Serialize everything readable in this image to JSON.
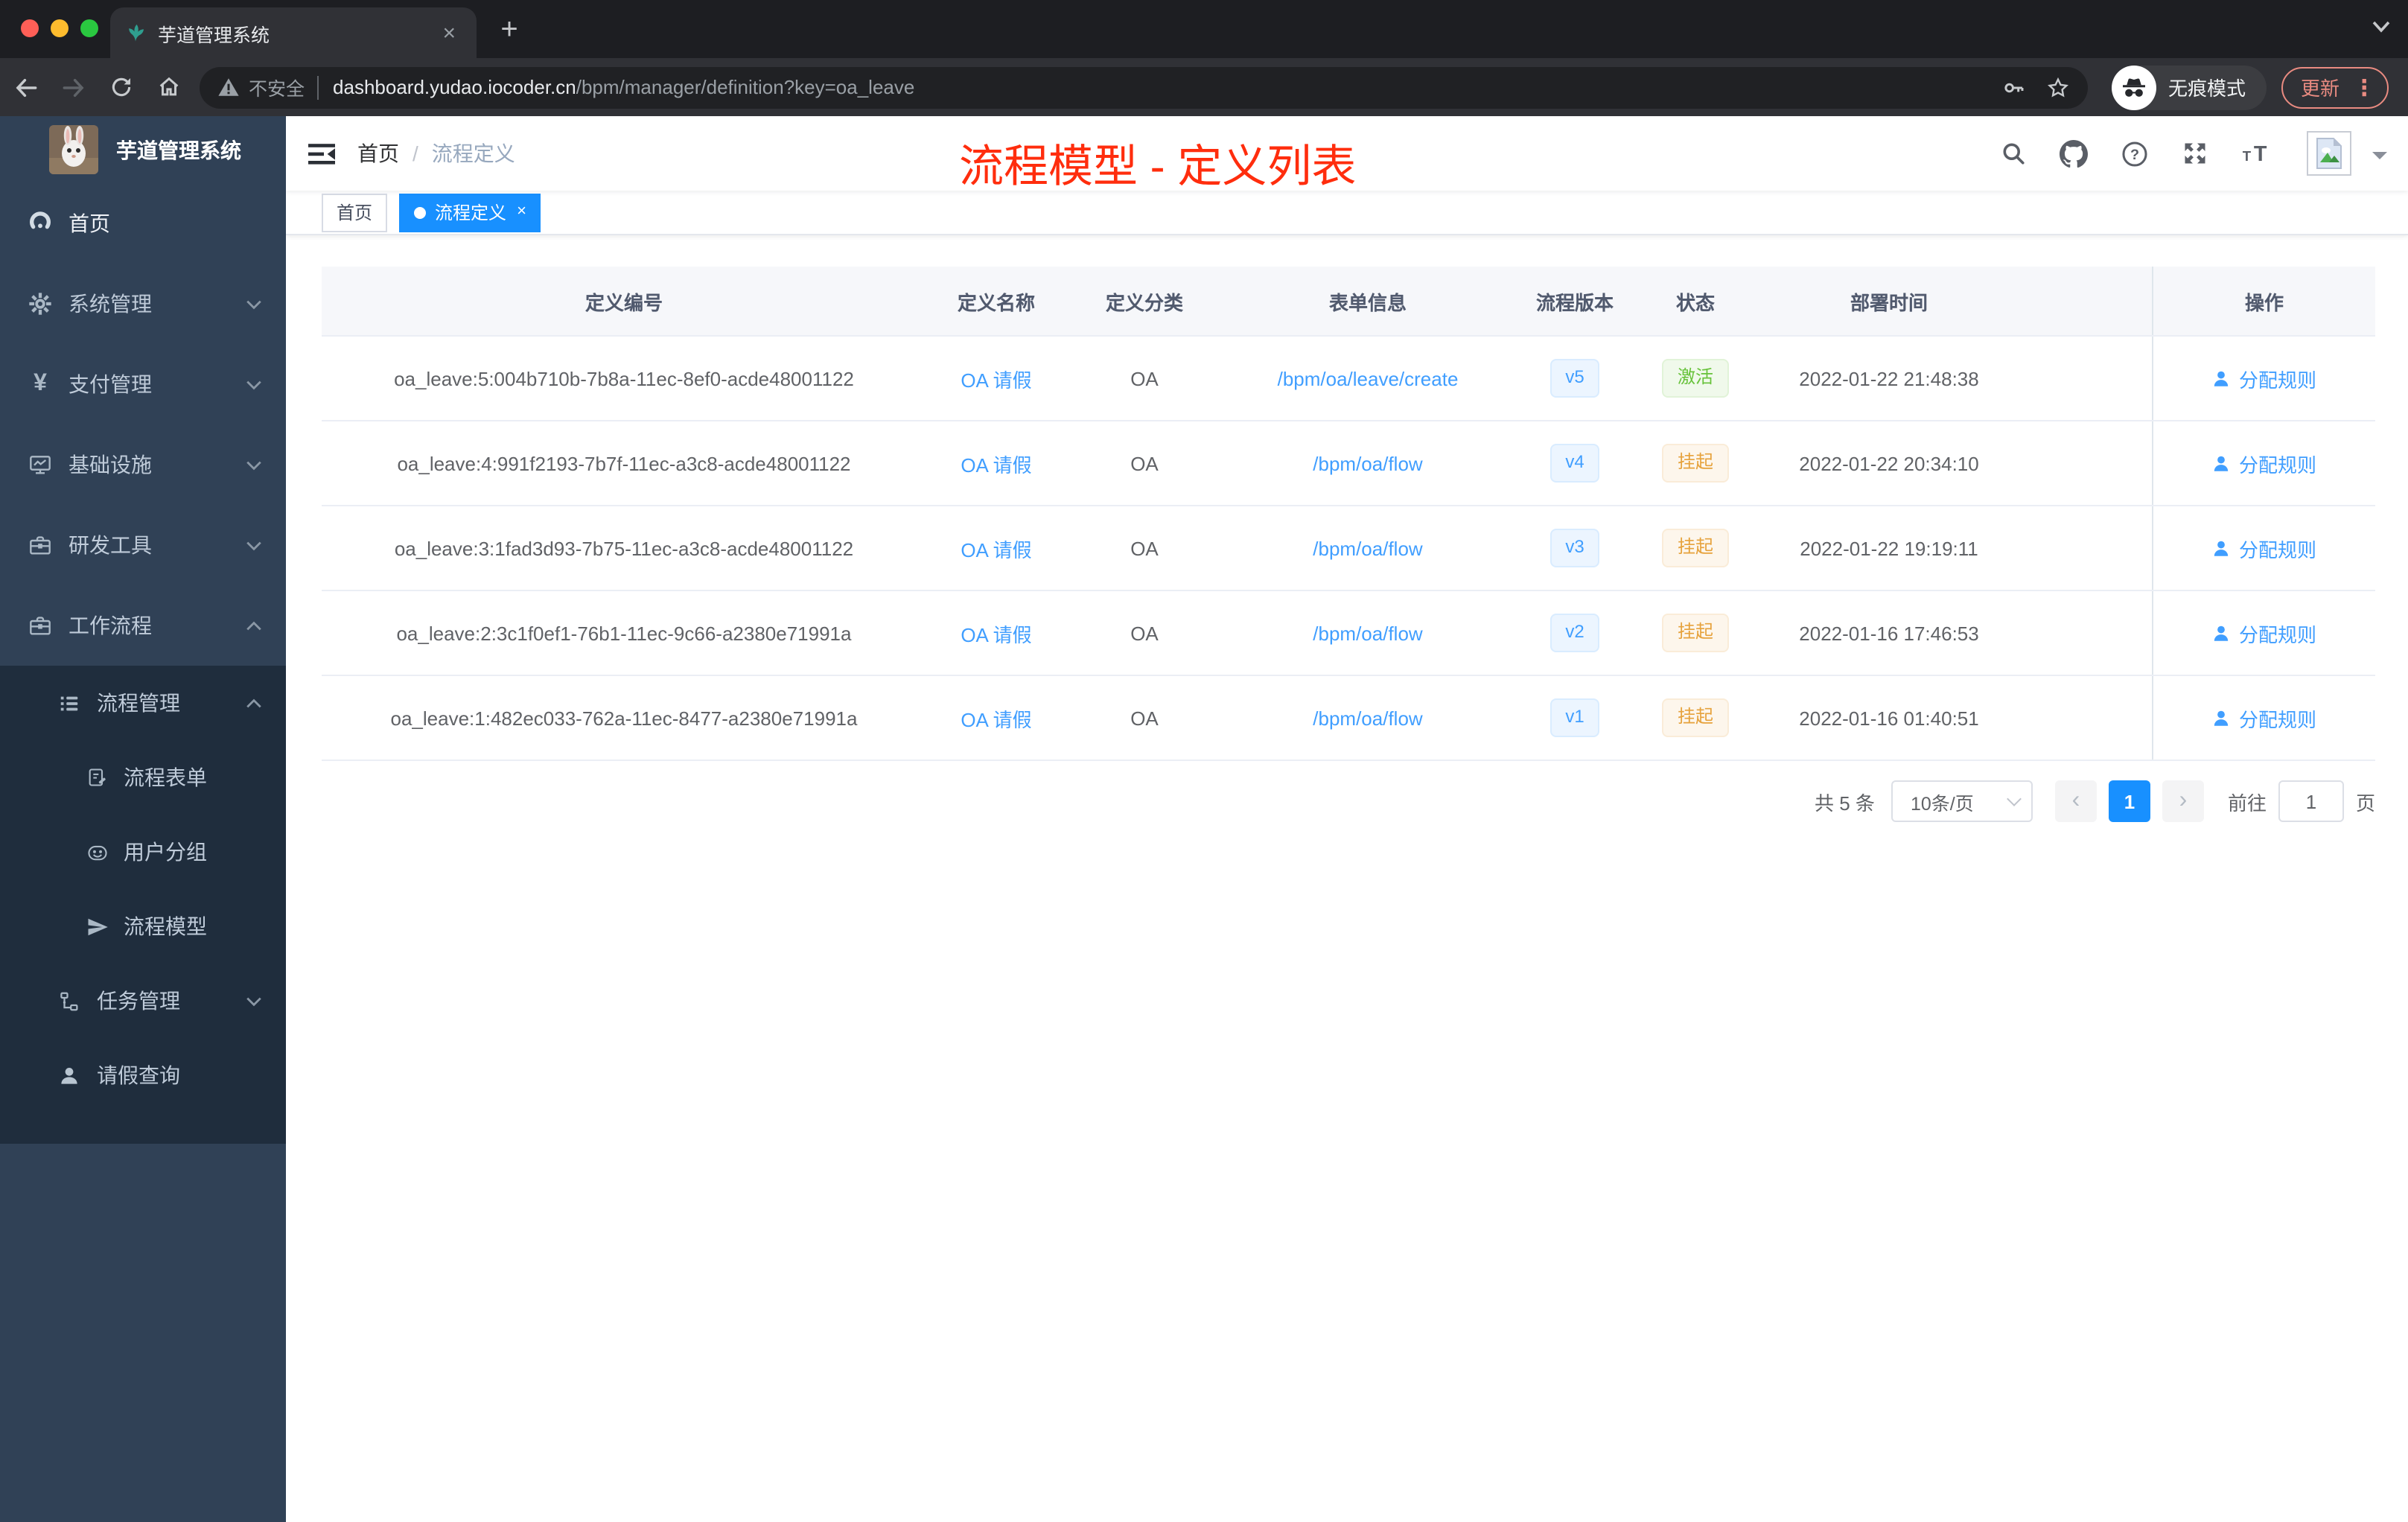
{
  "browser": {
    "tab_title": "芋道管理系统",
    "close_tab": "×",
    "new_tab": "+",
    "security_label": "不安全",
    "url_host": "dashboard.yudao.iocoder.cn",
    "url_path": "/bpm/manager/definition?key=oa_leave",
    "incognito_label": "无痕模式",
    "update_label": "更新",
    "menu_dots": "⋮"
  },
  "sidebar": {
    "logo_title": "芋道管理系统",
    "items": [
      {
        "label": "首页",
        "icon": "dashboard-icon"
      },
      {
        "label": "系统管理",
        "icon": "gear-icon"
      },
      {
        "label": "支付管理",
        "icon": "yen-icon",
        "yen_glyph": "¥"
      },
      {
        "label": "基础设施",
        "icon": "monitor-icon"
      },
      {
        "label": "研发工具",
        "icon": "toolbox-icon"
      },
      {
        "label": "工作流程",
        "icon": "toolbox-icon",
        "expanded": true
      }
    ],
    "submenu": {
      "groups": [
        {
          "label": "流程管理",
          "icon": "list-icon",
          "expanded": true
        },
        {
          "label": "任务管理",
          "icon": "tree-icon",
          "expanded": false
        },
        {
          "label": "请假查询",
          "icon": "user-icon"
        }
      ],
      "children": [
        {
          "label": "流程表单",
          "icon": "form-icon"
        },
        {
          "label": "用户分组",
          "icon": "robot-icon"
        },
        {
          "label": "流程模型",
          "icon": "paper-plane-icon"
        }
      ]
    }
  },
  "navbar": {
    "breadcrumb": {
      "home": "首页",
      "separator": "/",
      "current": "流程定义"
    },
    "annotation": "流程模型 - 定义列表"
  },
  "tags": {
    "home": "首页",
    "active": "流程定义",
    "close": "×"
  },
  "table": {
    "headers": [
      "定义编号",
      "定义名称",
      "定义分类",
      "表单信息",
      "流程版本",
      "状态",
      "部署时间",
      "操作"
    ],
    "rows": [
      {
        "id": "oa_leave:5:004b710b-7b8a-11ec-8ef0-acde48001122",
        "name": "OA 请假",
        "category": "OA",
        "form": "/bpm/oa/leave/create",
        "version": "v5",
        "status": "激活",
        "status_type": "success",
        "deploy_time": "2022-01-22 21:48:38",
        "action": "分配规则"
      },
      {
        "id": "oa_leave:4:991f2193-7b7f-11ec-a3c8-acde48001122",
        "name": "OA 请假",
        "category": "OA",
        "form": "/bpm/oa/flow",
        "version": "v4",
        "status": "挂起",
        "status_type": "warning",
        "deploy_time": "2022-01-22 20:34:10",
        "action": "分配规则"
      },
      {
        "id": "oa_leave:3:1fad3d93-7b75-11ec-a3c8-acde48001122",
        "name": "OA 请假",
        "category": "OA",
        "form": "/bpm/oa/flow",
        "version": "v3",
        "status": "挂起",
        "status_type": "warning",
        "deploy_time": "2022-01-22 19:19:11",
        "action": "分配规则"
      },
      {
        "id": "oa_leave:2:3c1f0ef1-76b1-11ec-9c66-a2380e71991a",
        "name": "OA 请假",
        "category": "OA",
        "form": "/bpm/oa/flow",
        "version": "v2",
        "status": "挂起",
        "status_type": "warning",
        "deploy_time": "2022-01-16 17:46:53",
        "action": "分配规则"
      },
      {
        "id": "oa_leave:1:482ec033-762a-11ec-8477-a2380e71991a",
        "name": "OA 请假",
        "category": "OA",
        "form": "/bpm/oa/flow",
        "version": "v1",
        "status": "挂起",
        "status_type": "warning",
        "deploy_time": "2022-01-16 01:40:51",
        "action": "分配规则"
      }
    ]
  },
  "pagination": {
    "total": "共 5 条",
    "page_size": "10条/页",
    "prev": "‹",
    "current": "1",
    "next": "›",
    "goto_label": "前往",
    "goto_value": "1",
    "goto_unit": "页"
  },
  "colors": {
    "accent": "#409eff",
    "tag_active": "#1890ff",
    "success": "#67c23a",
    "warning": "#e6a23c",
    "annotation": "#ff2d0d",
    "sidebar_bg": "#304156",
    "submenu_bg": "#1f2d3d"
  }
}
